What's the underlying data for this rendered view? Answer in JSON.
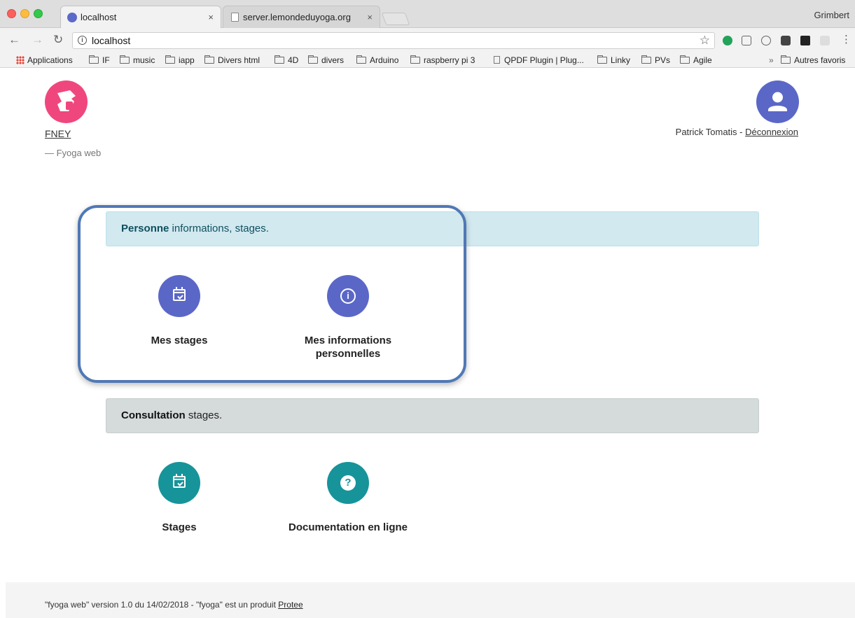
{
  "browser": {
    "profile_name": "Grimbert",
    "tabs": [
      {
        "title": "localhost",
        "close": "×"
      },
      {
        "title": "server.lemondeduyoga.org",
        "close": "×"
      }
    ],
    "address": "localhost",
    "bookmarks": {
      "apps": "Applications",
      "items": [
        "IF",
        "music",
        "iapp",
        "Divers html",
        "4D",
        "divers",
        "Arduino",
        "raspberry pi 3",
        "QPDF Plugin | Plug...",
        "Linky",
        "PVs",
        "Agile"
      ],
      "more": "»",
      "other": "Autres favoris"
    }
  },
  "header": {
    "brand": "FNEY",
    "subtitle": "— Fyoga web",
    "user_name": "Patrick Tomatis - ",
    "logout": "Déconnexion"
  },
  "sections": [
    {
      "title_bold": "Personne",
      "title_rest": " informations, stages.",
      "tiles": [
        {
          "label": "Mes stages",
          "icon": "calendar-check-icon",
          "color": "#5b67c7"
        },
        {
          "label": "Mes informations personnelles",
          "icon": "info-icon",
          "color": "#5b67c7"
        }
      ]
    },
    {
      "title_bold": "Consultation",
      "title_rest": " stages.",
      "tiles": [
        {
          "label": "Stages",
          "icon": "calendar-check-icon",
          "color": "#16949a"
        },
        {
          "label": "Documentation en ligne",
          "icon": "help-icon",
          "color": "#16949a"
        }
      ]
    }
  ],
  "footer": {
    "text": "\"fyoga web\" version 1.0 du 14/02/2018 - \"fyoga\" est un produit ",
    "link": "Protee"
  },
  "colors": {
    "accent": "#5b67c7",
    "teal": "#16949a",
    "logo": "#f0467e",
    "highlight_border": "#5078b5"
  }
}
